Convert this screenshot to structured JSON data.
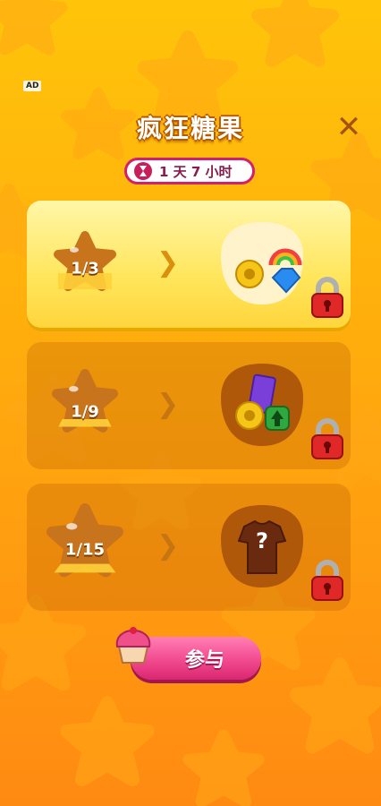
{
  "ad_label": "AD",
  "title": "疯狂糖果",
  "close_icon": "close-icon",
  "timer": {
    "text": "1 天 7 小时",
    "icon": "hourglass-icon"
  },
  "tiers": [
    {
      "progress": "1/3",
      "state": "active",
      "rewards": [
        "coin",
        "rainbow",
        "blue-gem"
      ],
      "locked": true
    },
    {
      "progress": "1/9",
      "state": "locked",
      "rewards": [
        "coin",
        "ticket",
        "green-badge"
      ],
      "locked": true
    },
    {
      "progress": "1/15",
      "state": "locked",
      "rewards": [
        "mystery-shirt"
      ],
      "reward_mark": "?",
      "locked": true
    }
  ],
  "join_button": {
    "label": "参与",
    "icon": "cupcake-icon"
  },
  "colors": {
    "accent_pink": "#F24A8F",
    "title_stroke": "#B85A00",
    "timer_border": "#D2206A"
  }
}
